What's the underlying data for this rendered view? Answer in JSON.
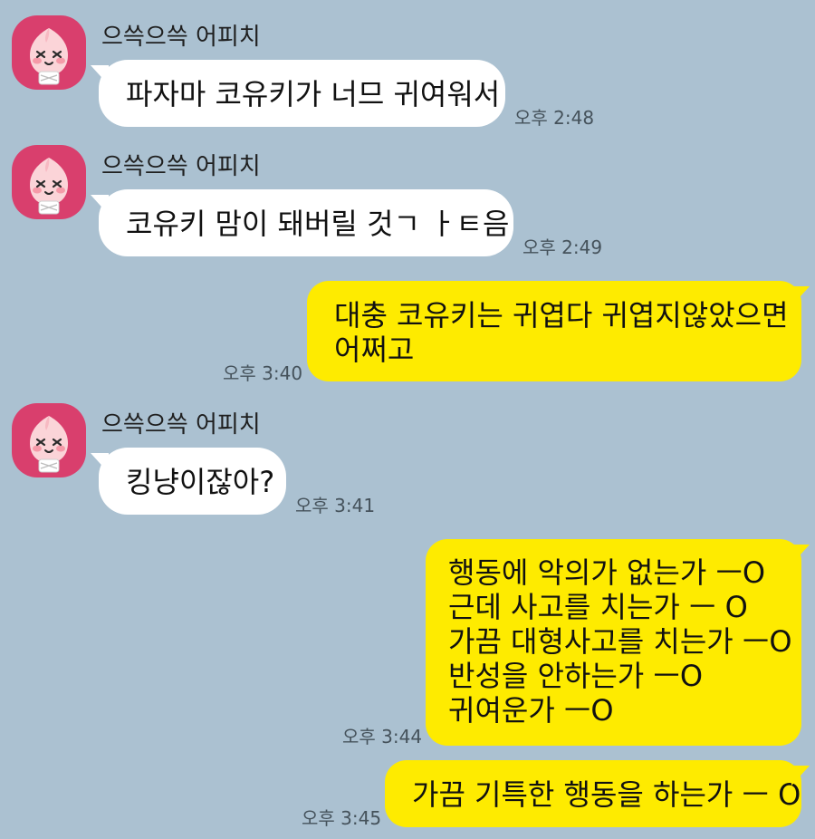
{
  "chat": {
    "messages": [
      {
        "sender": "으쓱으쓱 어피치",
        "text": "파자마 코유키가 너므 귀여워서",
        "time": "오후 2:48"
      },
      {
        "sender": "으쓱으쓱 어피치",
        "text": "코유키 맘이 돼버릴 것ㄱ ㅏㅌ음",
        "time": "오후 2:49"
      },
      {
        "sender": "me",
        "lines": [
          "대충 코유키는 귀엽다 귀엽지않았으면",
          "어쩌고"
        ],
        "time": "오후 3:40"
      },
      {
        "sender": "으쓱으쓱 어피치",
        "text": "킹냥이잖아?",
        "time": "오후 3:41"
      },
      {
        "sender": "me",
        "lines": [
          "행동에 악의가 없는가 ㅡO",
          "근데 사고를 치는가 ㅡ O",
          "가끔 대형사고를 치는가 ㅡO",
          "반성을 안하는가 ㅡO",
          "귀여운가 ㅡO"
        ],
        "time": "오후 3:44"
      },
      {
        "sender": "me",
        "text": "가끔 기특한 행동을 하는가 ㅡ O",
        "time": "오후 3:45"
      }
    ]
  },
  "colors": {
    "background": "#abc1d1",
    "outgoing_bubble": "#feeb00",
    "incoming_bubble": "#ffffff",
    "avatar_background": "#d93f6d"
  },
  "icons": {
    "avatar": "apeach-face-icon"
  }
}
